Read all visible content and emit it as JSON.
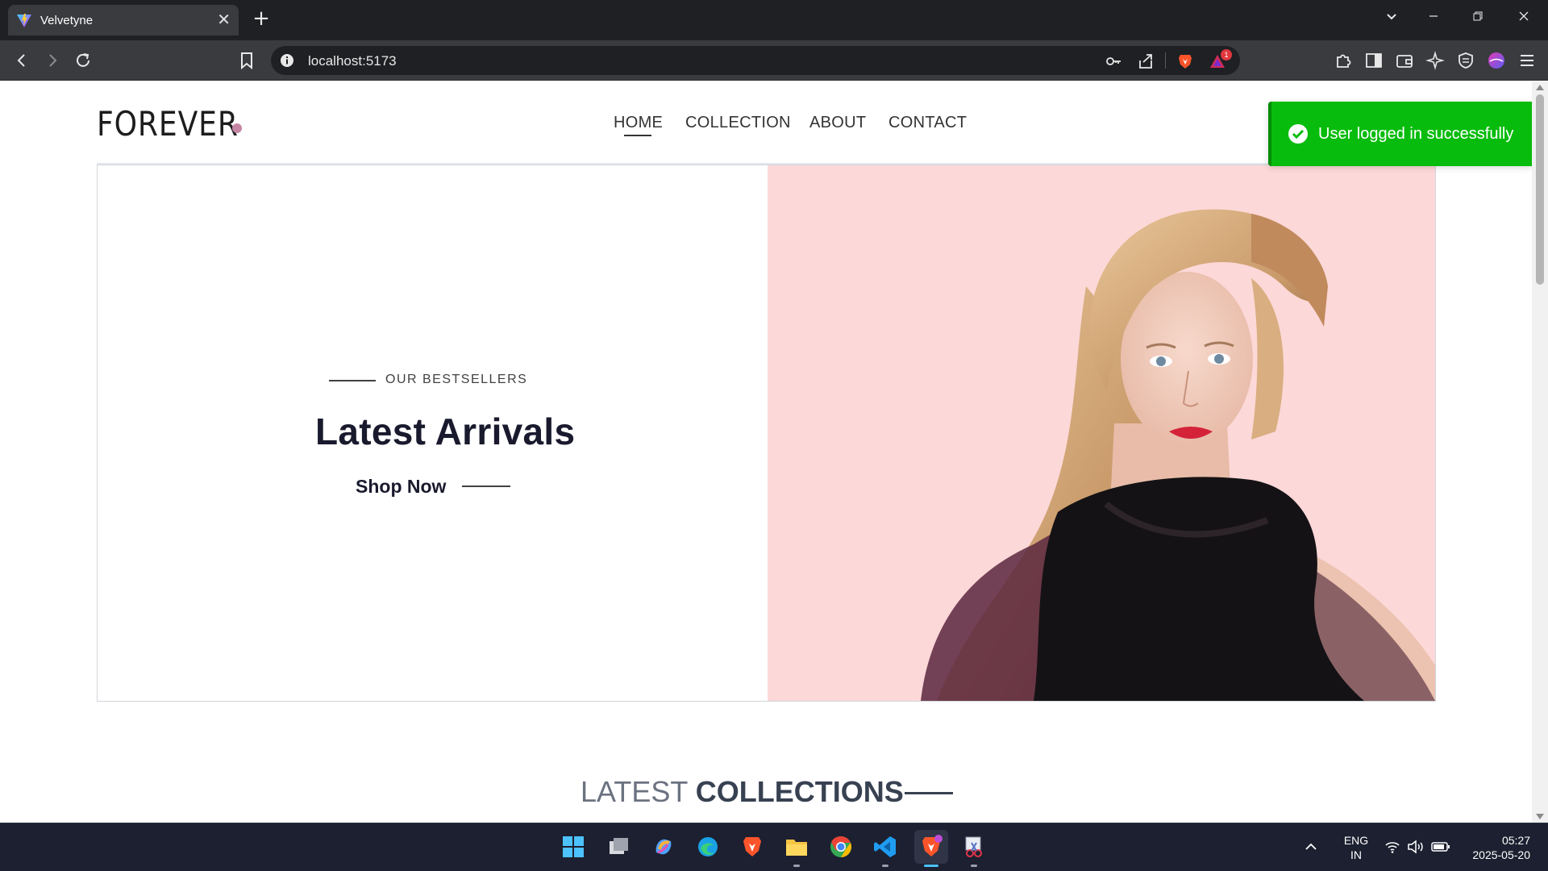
{
  "browser": {
    "tab_title": "Velvetyne",
    "tab_close": "✕",
    "new_tab": "+",
    "url": "localhost:5173",
    "notification_count": "1",
    "window_controls": [
      "chevron-down",
      "minimize",
      "restore",
      "close"
    ]
  },
  "site": {
    "logo": "FOREVER",
    "logo_dot_color": "#c586a5",
    "nav": [
      {
        "label": "HOME",
        "active": true
      },
      {
        "label": "COLLECTION"
      },
      {
        "label": "ABOUT"
      },
      {
        "label": "CONTACT"
      }
    ]
  },
  "toast": {
    "message": "User logged in successfully",
    "color": "#07bc0c",
    "icon": "check-circle-icon"
  },
  "hero": {
    "eyebrow": "OUR BESTSELLERS",
    "title": "Latest Arrivals",
    "cta": "Shop Now",
    "image_bg": "#fdd8d8",
    "image_alt": "model with black scarf"
  },
  "section": {
    "title_light": "LATEST",
    "title_bold": "COLLECTIONS"
  },
  "taskbar": {
    "apps": [
      "windows-start",
      "task-view",
      "copilot",
      "edge",
      "brave",
      "file-explorer",
      "chrome",
      "vscode",
      "brave-active",
      "snipping-tool"
    ],
    "lang_1": "ENG",
    "lang_2": "IN",
    "time": "05:27",
    "date": "2025-05-20"
  }
}
